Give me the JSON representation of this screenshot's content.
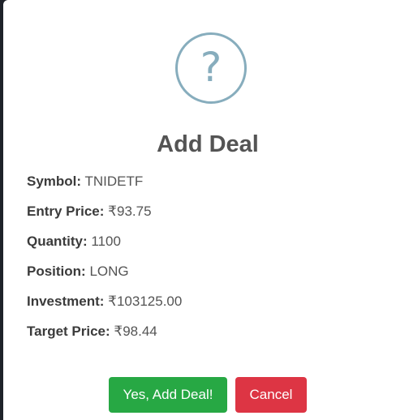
{
  "dialog": {
    "icon": "question-mark-icon",
    "icon_glyph": "?",
    "title": "Add Deal",
    "fields": [
      {
        "label": "Symbol:",
        "value": "TNIDETF"
      },
      {
        "label": "Entry Price:",
        "value": "₹93.75"
      },
      {
        "label": "Quantity:",
        "value": "1100"
      },
      {
        "label": "Position:",
        "value": "LONG"
      },
      {
        "label": "Investment:",
        "value": "₹103125.00"
      },
      {
        "label": "Target Price:",
        "value": "₹98.44"
      }
    ],
    "confirm_label": "Yes, Add Deal!",
    "cancel_label": "Cancel"
  },
  "colors": {
    "icon": "#87adbd",
    "confirm": "#27a844",
    "cancel": "#dd3544",
    "backdrop": "#1e2229"
  }
}
